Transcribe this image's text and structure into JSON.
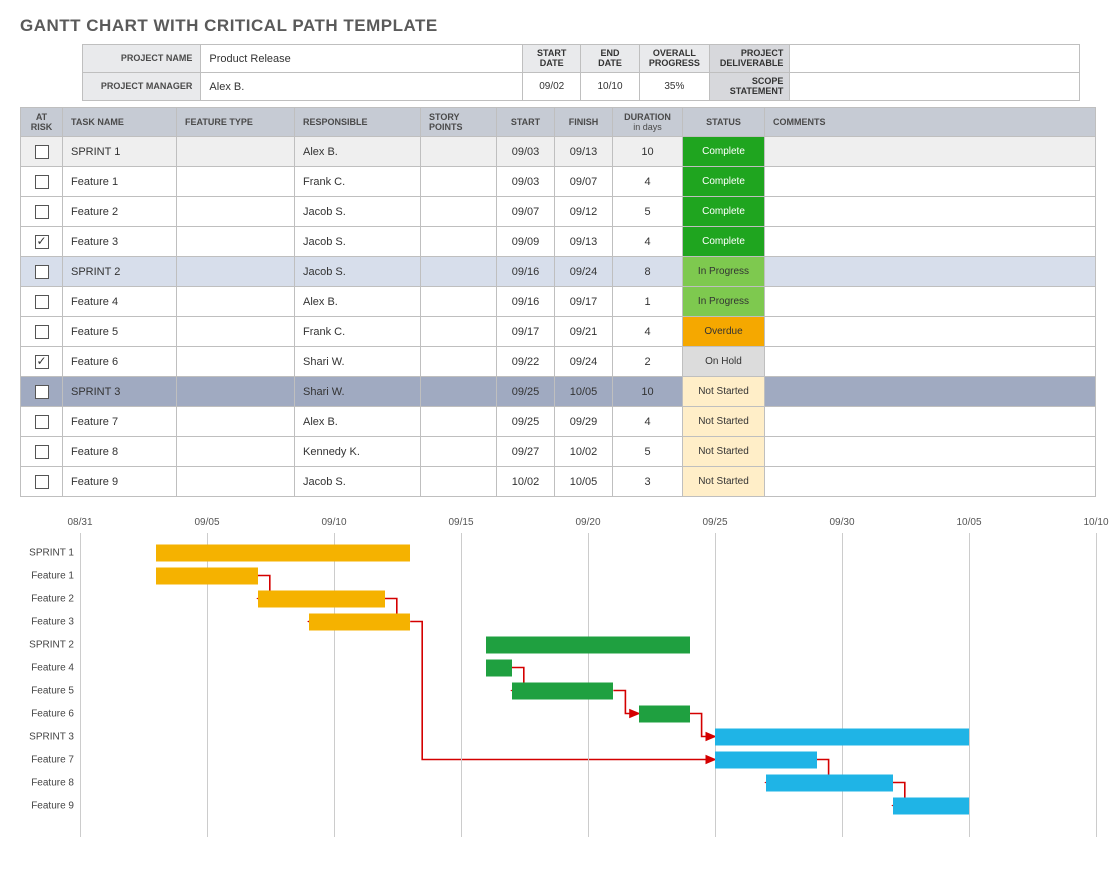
{
  "title": "GANTT CHART WITH CRITICAL PATH TEMPLATE",
  "info": {
    "project_name_label": "PROJECT NAME",
    "project_name": "Product Release",
    "project_manager_label": "PROJECT MANAGER",
    "project_manager": "Alex B.",
    "start_date_label": "START DATE",
    "start_date": "09/02",
    "end_date_label": "END DATE",
    "end_date": "10/10",
    "progress_label": "OVERALL PROGRESS",
    "progress": "35%",
    "deliverable_label": "PROJECT DELIVERABLE",
    "deliverable": "",
    "scope_label": "SCOPE STATEMENT",
    "scope": ""
  },
  "columns": {
    "at_risk": "AT RISK",
    "task_name": "TASK NAME",
    "feature_type": "FEATURE TYPE",
    "responsible": "RESPONSIBLE",
    "story_points": "STORY POINTS",
    "start": "START",
    "finish": "FINISH",
    "duration": "DURATION",
    "duration_sub": "in days",
    "status": "STATUS",
    "comments": "COMMENTS"
  },
  "status_labels": {
    "complete": "Complete",
    "inprogress": "In Progress",
    "overdue": "Overdue",
    "onhold": "On Hold",
    "notstarted": "Not Started"
  },
  "tasks": [
    {
      "at_risk": false,
      "name": "SPRINT 1",
      "ftype": "",
      "resp": "Alex B.",
      "story": "",
      "start": "09/03",
      "finish": "09/13",
      "dur": "10",
      "status": "complete",
      "row": "sprint1"
    },
    {
      "at_risk": false,
      "name": "Feature 1",
      "ftype": "",
      "resp": "Frank C.",
      "story": "",
      "start": "09/03",
      "finish": "09/07",
      "dur": "4",
      "status": "complete",
      "row": ""
    },
    {
      "at_risk": false,
      "name": "Feature 2",
      "ftype": "",
      "resp": "Jacob S.",
      "story": "",
      "start": "09/07",
      "finish": "09/12",
      "dur": "5",
      "status": "complete",
      "row": ""
    },
    {
      "at_risk": true,
      "name": "Feature 3",
      "ftype": "",
      "resp": "Jacob S.",
      "story": "",
      "start": "09/09",
      "finish": "09/13",
      "dur": "4",
      "status": "complete",
      "row": ""
    },
    {
      "at_risk": false,
      "name": "SPRINT 2",
      "ftype": "",
      "resp": "Jacob S.",
      "story": "",
      "start": "09/16",
      "finish": "09/24",
      "dur": "8",
      "status": "inprogress",
      "row": "sprint2"
    },
    {
      "at_risk": false,
      "name": "Feature 4",
      "ftype": "",
      "resp": "Alex B.",
      "story": "",
      "start": "09/16",
      "finish": "09/17",
      "dur": "1",
      "status": "inprogress",
      "row": ""
    },
    {
      "at_risk": false,
      "name": "Feature 5",
      "ftype": "",
      "resp": "Frank C.",
      "story": "",
      "start": "09/17",
      "finish": "09/21",
      "dur": "4",
      "status": "overdue",
      "row": ""
    },
    {
      "at_risk": true,
      "name": "Feature 6",
      "ftype": "",
      "resp": "Shari W.",
      "story": "",
      "start": "09/22",
      "finish": "09/24",
      "dur": "2",
      "status": "onhold",
      "row": ""
    },
    {
      "at_risk": false,
      "name": "SPRINT 3",
      "ftype": "",
      "resp": "Shari W.",
      "story": "",
      "start": "09/25",
      "finish": "10/05",
      "dur": "10",
      "status": "notstarted",
      "row": "sprint3"
    },
    {
      "at_risk": false,
      "name": "Feature 7",
      "ftype": "",
      "resp": "Alex B.",
      "story": "",
      "start": "09/25",
      "finish": "09/29",
      "dur": "4",
      "status": "notstarted",
      "row": ""
    },
    {
      "at_risk": false,
      "name": "Feature 8",
      "ftype": "",
      "resp": "Kennedy K.",
      "story": "",
      "start": "09/27",
      "finish": "10/02",
      "dur": "5",
      "status": "notstarted",
      "row": ""
    },
    {
      "at_risk": false,
      "name": "Feature 9",
      "ftype": "",
      "resp": "Jacob S.",
      "story": "",
      "start": "10/02",
      "finish": "10/05",
      "dur": "3",
      "status": "notstarted",
      "row": ""
    }
  ],
  "chart_data": {
    "type": "bar",
    "title": "",
    "xlabel": "",
    "ylabel": "",
    "x_ticks": [
      "08/31",
      "09/05",
      "09/10",
      "09/15",
      "09/20",
      "09/25",
      "09/30",
      "10/05",
      "10/10"
    ],
    "x_range": [
      "08/31",
      "10/10"
    ],
    "categories": [
      "SPRINT 1",
      "Feature 1",
      "Feature 2",
      "Feature 3",
      "SPRINT 2",
      "Feature 4",
      "Feature 5",
      "Feature 6",
      "SPRINT 3",
      "Feature 7",
      "Feature 8",
      "Feature 9"
    ],
    "bars": [
      {
        "name": "SPRINT 1",
        "start": "09/03",
        "end": "09/13",
        "color": "orange"
      },
      {
        "name": "Feature 1",
        "start": "09/03",
        "end": "09/07",
        "color": "orange"
      },
      {
        "name": "Feature 2",
        "start": "09/07",
        "end": "09/12",
        "color": "orange"
      },
      {
        "name": "Feature 3",
        "start": "09/09",
        "end": "09/13",
        "color": "orange"
      },
      {
        "name": "SPRINT 2",
        "start": "09/16",
        "end": "09/24",
        "color": "green"
      },
      {
        "name": "Feature 4",
        "start": "09/16",
        "end": "09/17",
        "color": "green"
      },
      {
        "name": "Feature 5",
        "start": "09/17",
        "end": "09/21",
        "color": "green"
      },
      {
        "name": "Feature 6",
        "start": "09/22",
        "end": "09/24",
        "color": "green"
      },
      {
        "name": "SPRINT 3",
        "start": "09/25",
        "end": "10/05",
        "color": "blue"
      },
      {
        "name": "Feature 7",
        "start": "09/25",
        "end": "09/29",
        "color": "blue"
      },
      {
        "name": "Feature 8",
        "start": "09/27",
        "end": "10/02",
        "color": "blue"
      },
      {
        "name": "Feature 9",
        "start": "10/02",
        "end": "10/05",
        "color": "blue"
      }
    ],
    "critical_path_arrows": [
      {
        "from": "Feature 1",
        "to": "Feature 2"
      },
      {
        "from": "Feature 2",
        "to": "Feature 3"
      },
      {
        "from": "Feature 3",
        "to": "Feature 7"
      },
      {
        "from": "Feature 4",
        "to": "Feature 5"
      },
      {
        "from": "Feature 5",
        "to": "Feature 6"
      },
      {
        "from": "Feature 6",
        "to": "SPRINT 3"
      },
      {
        "from": "Feature 7",
        "to": "Feature 8"
      },
      {
        "from": "Feature 8",
        "to": "Feature 9"
      }
    ]
  }
}
